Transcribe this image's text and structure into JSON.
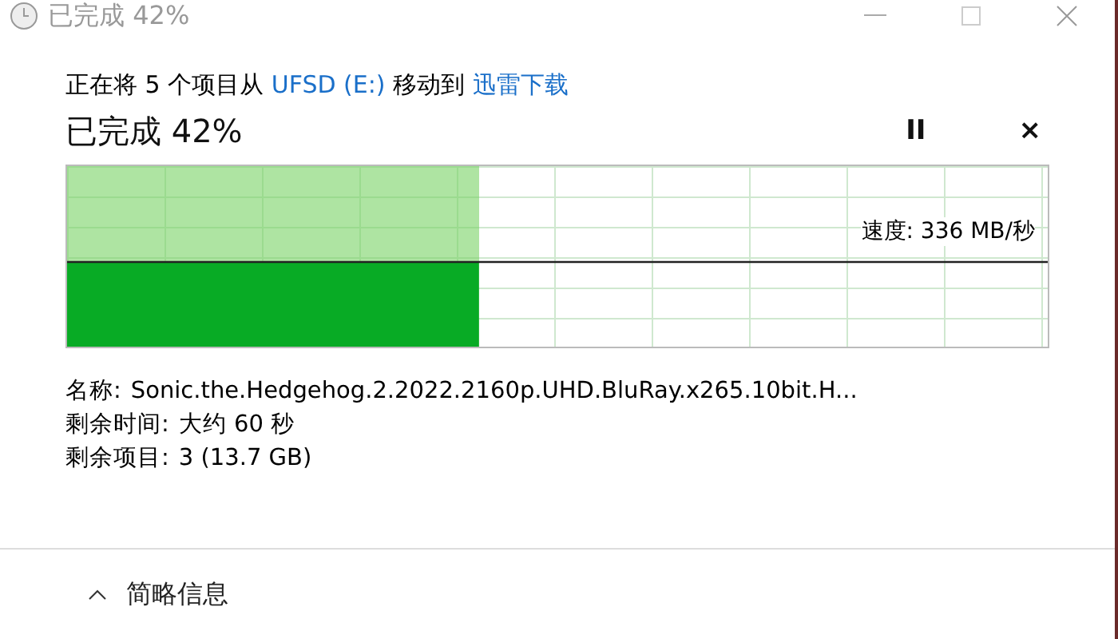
{
  "window": {
    "title": "已完成 42%"
  },
  "header": {
    "parts": [
      {
        "text": "正在将 5 个项目从 ",
        "kind": "plain"
      },
      {
        "text": "UFSD (E:)",
        "kind": "link"
      },
      {
        "text": " 移动到 ",
        "kind": "plain"
      },
      {
        "text": "迅雷下载",
        "kind": "link"
      }
    ],
    "status": "已完成 42%",
    "pause": "II",
    "cancel": "×"
  },
  "progress": {
    "level": 0.42,
    "speed": "速度: 336 MB/秒"
  },
  "details": [
    {
      "label": "名称:",
      "value": "Sonic.the.Hedgehog.2.2022.2160p.UHD.BluRay.x265.10bit.H..."
    },
    {
      "label": "剩余时间:",
      "value": "大约 60 秒"
    },
    {
      "label": "剩余项目:",
      "value": "3 (13.7 GB)"
    }
  ],
  "footer": {
    "toggle": "简略信息",
    "expanded": true
  }
}
